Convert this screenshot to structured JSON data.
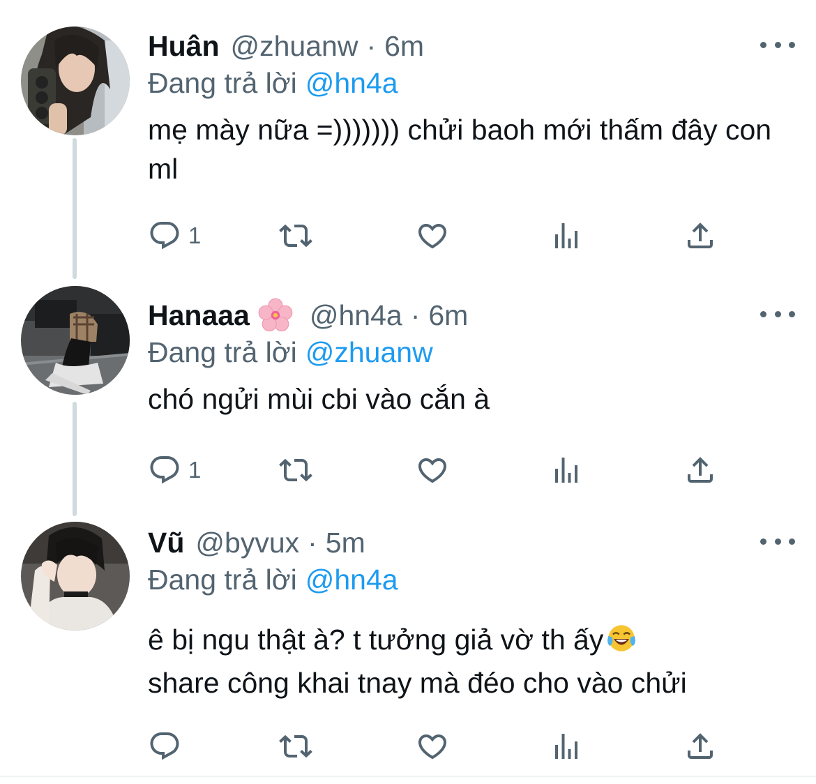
{
  "reply_prefix": "Đang trả lời",
  "separator": "·",
  "colors": {
    "text": "#0f1419",
    "secondary": "#536471",
    "link": "#1d9bf0",
    "thread_line": "#cfd9de"
  },
  "tweets": [
    {
      "name": "Huân",
      "handle": "@zhuanw",
      "time": "6m",
      "replying_to": "@hn4a",
      "text": "mẹ mày nữa =))))))) chửi baoh mới thấm đây con ml",
      "reply_count": "1",
      "retweet_count": "",
      "like_count": ""
    },
    {
      "name": "Hanaaa",
      "name_emoji": "cherry-blossom-emoji",
      "handle": "@hn4a",
      "time": "6m",
      "replying_to": "@zhuanw",
      "text": "chó ngửi mùi cbi vào cắn à",
      "reply_count": "1",
      "retweet_count": "",
      "like_count": ""
    },
    {
      "name": "Vũ",
      "handle": "@byvux",
      "time": "5m",
      "replying_to": "@hn4a",
      "text_line1": "ê bị ngu thật à? t tưởng giả vờ th ấy",
      "text_emoji": "face-with-tears-of-joy-emoji",
      "text_line2": "share công khai tnay mà đéo cho vào chửi",
      "reply_count": "",
      "retweet_count": "",
      "like_count": ""
    }
  ],
  "icons": [
    "reply-icon",
    "retweet-icon",
    "like-icon",
    "views-icon",
    "share-icon",
    "more-icon"
  ]
}
